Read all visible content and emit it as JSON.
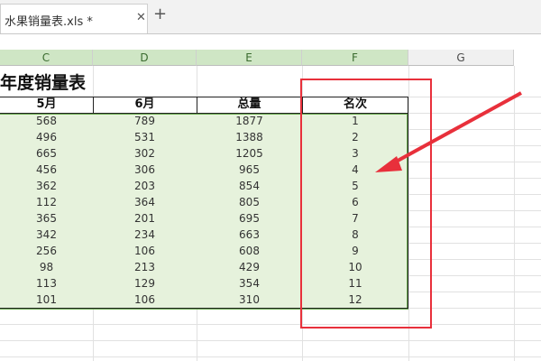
{
  "tab": {
    "title": "水果销量表.xls *",
    "close_glyph": "✕",
    "add_glyph": "+"
  },
  "columns": [
    {
      "letter": "C",
      "selected": true
    },
    {
      "letter": "D",
      "selected": true
    },
    {
      "letter": "E",
      "selected": true
    },
    {
      "letter": "F",
      "selected": true
    },
    {
      "letter": "G",
      "selected": false
    }
  ],
  "sheet_title": "年度销量表",
  "headers": [
    "5月",
    "6月",
    "总量",
    "名次"
  ],
  "rows": [
    [
      "568",
      "789",
      "1877",
      "1"
    ],
    [
      "496",
      "531",
      "1388",
      "2"
    ],
    [
      "665",
      "302",
      "1205",
      "3"
    ],
    [
      "456",
      "306",
      "965",
      "4"
    ],
    [
      "362",
      "203",
      "854",
      "5"
    ],
    [
      "112",
      "364",
      "805",
      "6"
    ],
    [
      "365",
      "201",
      "695",
      "7"
    ],
    [
      "342",
      "234",
      "663",
      "8"
    ],
    [
      "256",
      "106",
      "608",
      "9"
    ],
    [
      "98",
      "213",
      "429",
      "10"
    ],
    [
      "113",
      "129",
      "354",
      "11"
    ],
    [
      "101",
      "106",
      "310",
      "12"
    ]
  ],
  "colors": {
    "selection_fill": "#e6f2dc",
    "selection_border": "#6aaa4f",
    "annotation_red": "#e8303b"
  },
  "icons": {
    "tab_close": "close-icon",
    "new_tab": "plus-icon"
  }
}
